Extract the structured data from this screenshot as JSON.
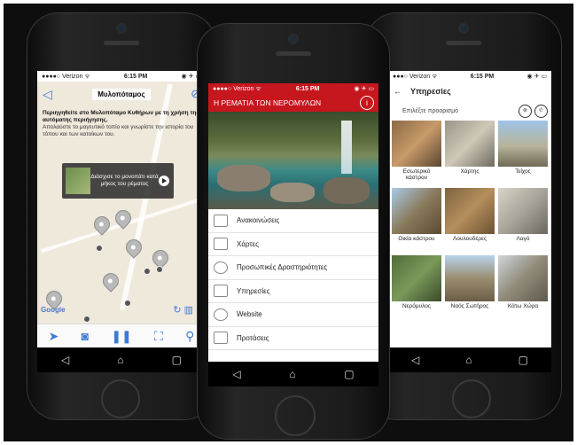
{
  "status_bars": {
    "left": {
      "carrier": "●●●●○ Verizon ᯤ",
      "time": "6:15 PM",
      "right": "◉ ✈ ▭"
    },
    "center": {
      "carrier": "●●●●○ Verizon ᯤ",
      "time": "6:15 PM",
      "right": "◉ ✈ ▭"
    },
    "right": {
      "carrier": "●●●○ Verizon ᯤ",
      "time": "6:15 PM",
      "right": "◉ ✈ ▭"
    }
  },
  "left_screen": {
    "title": "Μυλοπόταμος",
    "intro_bold": "Περιηγηθείτε στο Μυλοπόταμο Κυθήρων με τη χρήση της αυτόματης περιήγησης.",
    "intro_text": "Απολαύστε το μαγευτικό τοπίο και γνωρίστε την ιστορία του τόπου και των κατοίκων του.",
    "popup_text": "Διάσχισε το μονοπάτι κατά μήκος του ρέματος",
    "google_label": "Google"
  },
  "center_screen": {
    "header_title": "Η ΡΕΜΑΤΙΑ ΤΩΝ ΝΕΡΟΜΥΛΩΝ",
    "menu": [
      {
        "label": "Ανακοινώσεις",
        "icon": "announcements-icon"
      },
      {
        "label": "Χάρτες",
        "icon": "map-icon"
      },
      {
        "label": "Προσωπικές Δραστηριότητες",
        "icon": "user-icon"
      },
      {
        "label": "Υπηρεσίες",
        "icon": "services-icon"
      },
      {
        "label": "Website",
        "icon": "globe-icon"
      },
      {
        "label": "Προτάσεις",
        "icon": "suggestions-icon"
      }
    ]
  },
  "right_screen": {
    "title": "Υπηρεσίες",
    "subtitle": "Επιλέξτε προορισμό",
    "places": [
      {
        "label": "Εσωτερικό κάστρου"
      },
      {
        "label": "Χάρτης"
      },
      {
        "label": "Τείχος"
      },
      {
        "label": "Οικία κάστρου"
      },
      {
        "label": "Λουλουδέρες"
      },
      {
        "label": "Λαγό"
      },
      {
        "label": "Νερόμυλος"
      },
      {
        "label": "Ναός Σωτήρος"
      },
      {
        "label": "Κάτω Χώρα"
      }
    ]
  },
  "colors": {
    "brand_red": "#c6161e",
    "map_blue": "#3a7bd5"
  }
}
